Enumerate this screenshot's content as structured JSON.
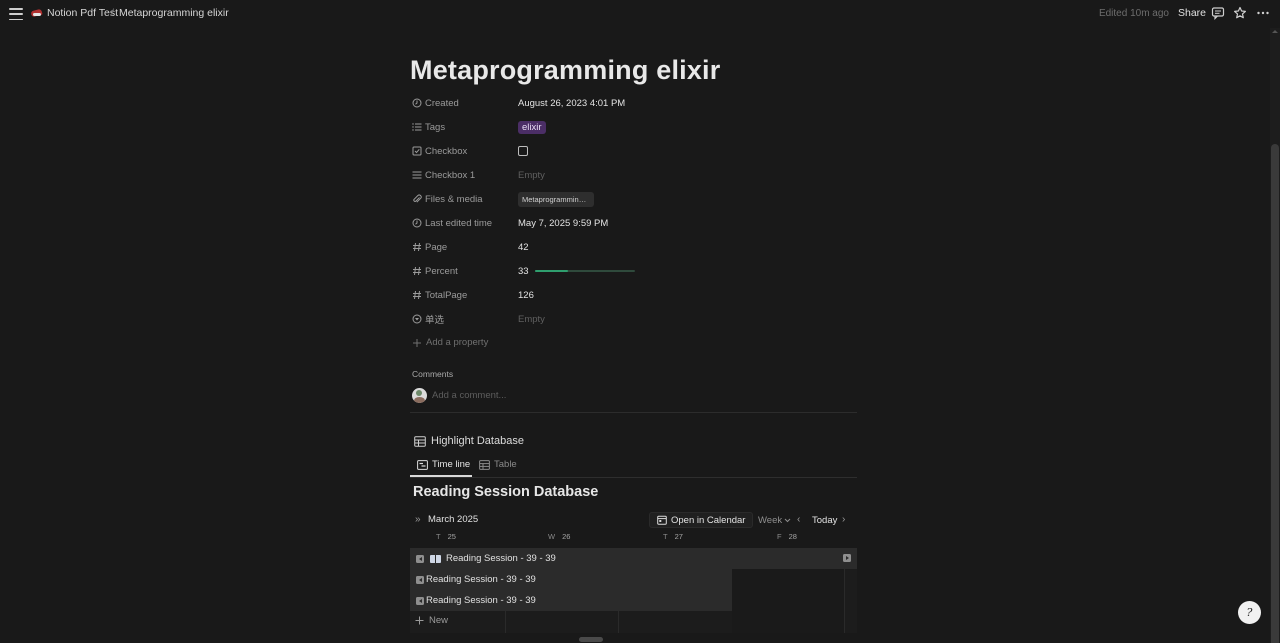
{
  "topbar": {
    "workspace": "Notion Pdf Test",
    "separator": "/",
    "page": "Metaprogramming elixir",
    "edited": "Edited 10m ago",
    "share": "Share"
  },
  "page": {
    "title": "Metaprogramming elixir"
  },
  "properties": [
    {
      "label": "Created",
      "value": "August 26, 2023 4:01 PM",
      "icon": "clock-icon"
    },
    {
      "label": "Tags",
      "value": "elixir",
      "icon": "list-icon"
    },
    {
      "label": "Checkbox",
      "value": "",
      "icon": "checkbox-icon"
    },
    {
      "label": "Checkbox 1",
      "value": "Empty",
      "icon": "list-icon"
    },
    {
      "label": "Files & media",
      "value": "Metaprogramming Elixir.pdf",
      "icon": "paperclip-icon"
    },
    {
      "label": "Last edited time",
      "value": "May 7, 2025 9:59 PM",
      "icon": "clock-icon"
    },
    {
      "label": "Page",
      "value": "42",
      "icon": "hash-icon"
    },
    {
      "label": "Percent",
      "value": "33",
      "icon": "hash-icon",
      "progress": 0.33
    },
    {
      "label": "TotalPage",
      "value": "126",
      "icon": "hash-icon"
    },
    {
      "label": "单选",
      "value": "Empty",
      "icon": "select-icon"
    }
  ],
  "add_property": "Add a property",
  "comments": {
    "heading": "Comments",
    "placeholder": "Add a comment..."
  },
  "database": {
    "title": "Highlight Database",
    "tabs": [
      {
        "label": "Time line",
        "active": true
      },
      {
        "label": "Table",
        "active": false
      }
    ],
    "view_title": "Reading Session Database",
    "calendar": {
      "month": "March 2025",
      "open_in_calendar": "Open in Calendar",
      "week": "Week",
      "today": "Today",
      "days": [
        {
          "weekday": "T",
          "date": "25"
        },
        {
          "weekday": "W",
          "date": "26"
        },
        {
          "weekday": "T",
          "date": "27"
        },
        {
          "weekday": "F",
          "date": "28"
        }
      ]
    },
    "events": [
      {
        "label": "Reading Session - 39 - 39"
      },
      {
        "label": "Reading Session - 39 - 39"
      },
      {
        "label": "Reading Session - 39 - 39"
      }
    ],
    "new_label": "New"
  },
  "help": {
    "label": "?"
  },
  "colors": {
    "background": "#191919",
    "tag_elixir": "#4b2e66",
    "progress": "#2f9e6e"
  }
}
